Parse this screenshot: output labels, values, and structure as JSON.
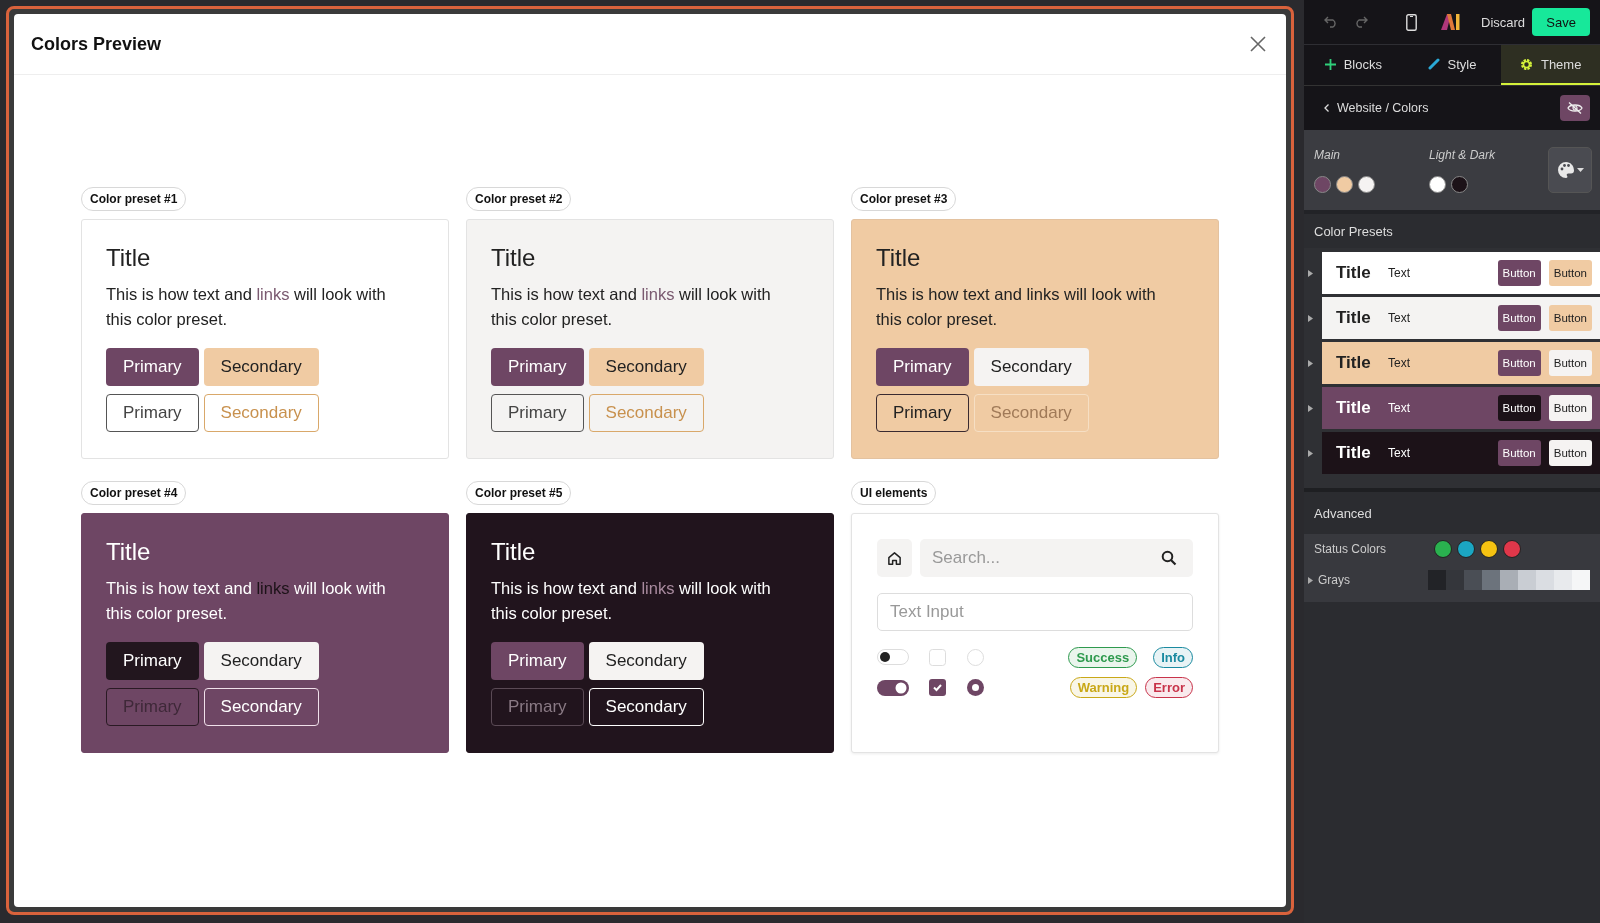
{
  "modal": {
    "title": "Colors Preview",
    "presets": [
      {
        "label": "Color preset #1",
        "title": "Title",
        "text": "This is how text and ",
        "link": "links",
        "text_end": " will look with this color preset.",
        "buttons": [
          "Primary",
          "Secondary",
          "Primary",
          "Secondary"
        ]
      },
      {
        "label": "Color preset #2",
        "title": "Title",
        "text": "This is how text and ",
        "link": "links",
        "text_end": " will look with this color preset.",
        "buttons": [
          "Primary",
          "Secondary",
          "Primary",
          "Secondary"
        ]
      },
      {
        "label": "Color preset #3",
        "title": "Title",
        "text": "This is how text and ",
        "link": "links",
        "text_end": " will look with this color preset.",
        "buttons": [
          "Primary",
          "Secondary",
          "Primary",
          "Secondary"
        ]
      },
      {
        "label": "Color preset #4",
        "title": "Title",
        "text": "This is how text and ",
        "link": "links",
        "text_end": " will look with this color preset.",
        "buttons": [
          "Primary",
          "Secondary",
          "Primary",
          "Secondary"
        ]
      },
      {
        "label": "Color preset #5",
        "title": "Title",
        "text": "This is how text and ",
        "link": "links",
        "text_end": " will look with this color preset.",
        "buttons": [
          "Primary",
          "Secondary",
          "Primary",
          "Secondary"
        ]
      }
    ],
    "ui_elements": {
      "label": "UI elements",
      "search": {
        "placeholder": "Search..."
      },
      "text_input": {
        "placeholder": "Text Input"
      },
      "controls": [
        {
          "kind": "toggle",
          "on": false
        },
        {
          "kind": "checkbox",
          "checked": false
        },
        {
          "kind": "radio",
          "selected": false
        },
        {
          "kind": "toggle",
          "on": true
        },
        {
          "kind": "checkbox",
          "checked": true
        },
        {
          "kind": "radio",
          "selected": true
        }
      ],
      "badges": [
        {
          "label": "Success",
          "color": "#2e9a4e"
        },
        {
          "label": "Info",
          "color": "#1a8aa0"
        },
        {
          "label": "Warning",
          "color": "#c9a818"
        },
        {
          "label": "Error",
          "color": "#c8334a"
        }
      ]
    }
  },
  "sidebar": {
    "toolbar": {
      "discard": "Discard",
      "save": "Save"
    },
    "tabs": [
      {
        "label": "Blocks",
        "selected": false
      },
      {
        "label": "Style",
        "selected": false
      },
      {
        "label": "Theme",
        "selected": true
      }
    ],
    "breadcrumb": "Website / Colors",
    "main": {
      "label": "Main",
      "colors": [
        {
          "color": "#6e4664"
        },
        {
          "color": "#f0cba3"
        },
        {
          "color": "#f5f3f2"
        }
      ]
    },
    "light_dark": {
      "label": "Light & Dark",
      "colors": [
        {
          "color": "#ffffff"
        },
        {
          "color": "#1c1218"
        }
      ]
    },
    "color_presets": {
      "heading": "Color Presets",
      "items": [
        {
          "title": "Title",
          "text": "Text",
          "buttons": [
            "Button",
            "Button"
          ],
          "expanded": false
        },
        {
          "title": "Title",
          "text": "Text",
          "buttons": [
            "Button",
            "Button"
          ],
          "expanded": false
        },
        {
          "title": "Title",
          "text": "Text",
          "buttons": [
            "Button",
            "Button"
          ],
          "expanded": false
        },
        {
          "title": "Title",
          "text": "Text",
          "buttons": [
            "Button",
            "Button"
          ],
          "expanded": false
        },
        {
          "title": "Title",
          "text": "Text",
          "buttons": [
            "Button",
            "Button"
          ],
          "expanded": false
        }
      ]
    },
    "advanced": {
      "heading": "Advanced",
      "status_label": "Status Colors",
      "status_colors": [
        {
          "color": "#2ab14f"
        },
        {
          "color": "#1ba6c2"
        },
        {
          "color": "#f5c211"
        },
        {
          "color": "#e0374a"
        }
      ],
      "grays_label": "Grays",
      "grays_expanded": false,
      "grays": [
        {
          "color": "#222327"
        },
        {
          "color": "#34363b"
        },
        {
          "color": "#4a4e55"
        },
        {
          "color": "#6c737c"
        },
        {
          "color": "#a9aeb5"
        },
        {
          "color": "#c9cdd3"
        },
        {
          "color": "#dadde2"
        },
        {
          "color": "#e8eaed"
        },
        {
          "color": "#f5f6f7"
        }
      ]
    }
  }
}
